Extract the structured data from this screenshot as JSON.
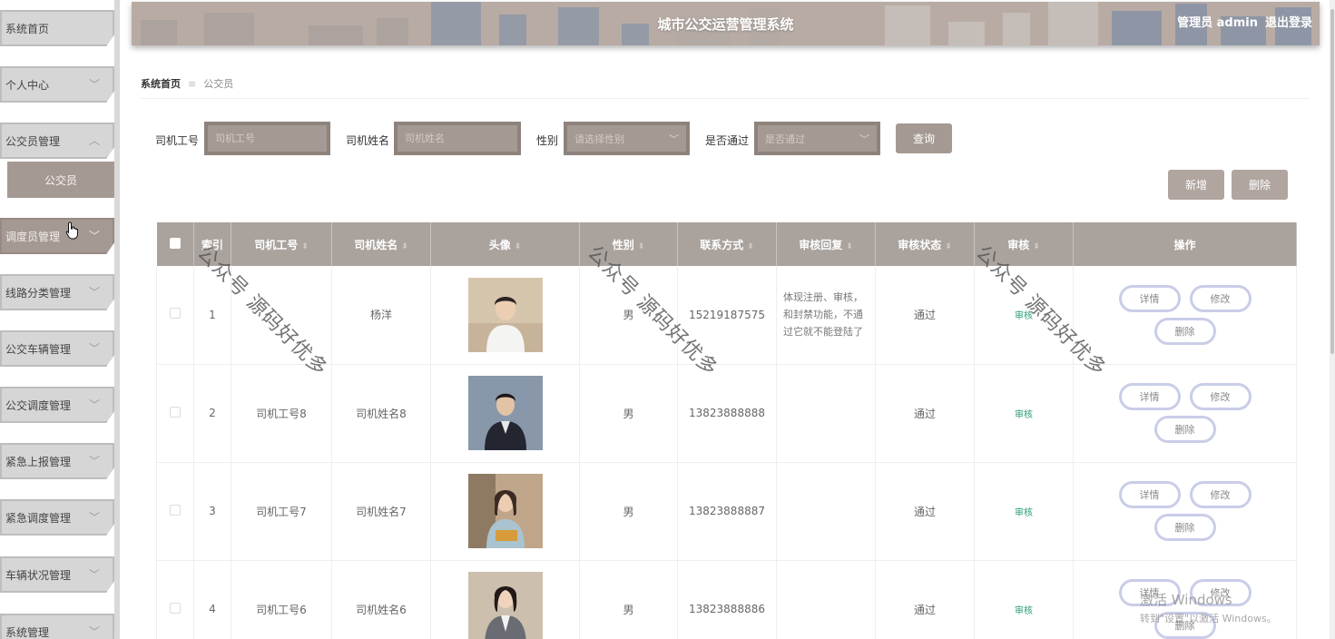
{
  "header": {
    "title": "城市公交运营管理系统",
    "user": "管理员 admin",
    "logout": "退出登录"
  },
  "sidebar": {
    "items": [
      {
        "label": "系统首页",
        "chevron": ""
      },
      {
        "label": "个人中心",
        "chevron": "﹀"
      },
      {
        "label": "公交员管理",
        "chevron": "︿"
      },
      {
        "label": "调度员管理",
        "chevron": "﹀"
      },
      {
        "label": "线路分类管理",
        "chevron": "﹀"
      },
      {
        "label": "公交车辆管理",
        "chevron": "﹀"
      },
      {
        "label": "公交调度管理",
        "chevron": "﹀"
      },
      {
        "label": "紧急上报管理",
        "chevron": "﹀"
      },
      {
        "label": "紧急调度管理",
        "chevron": "﹀"
      },
      {
        "label": "车辆状况管理",
        "chevron": "﹀"
      },
      {
        "label": "系统管理",
        "chevron": "﹀"
      }
    ],
    "submenu": {
      "label": "公交员"
    }
  },
  "breadcrumb": {
    "home": "系统首页",
    "separator": "≡",
    "current": "公交员"
  },
  "search": {
    "driver_id_label": "司机工号",
    "driver_id_placeholder": "司机工号",
    "driver_name_label": "司机姓名",
    "driver_name_placeholder": "司机姓名",
    "gender_label": "性别",
    "gender_placeholder": "请选择性别",
    "passed_label": "是否通过",
    "passed_placeholder": "是否通过",
    "query_button": "查询"
  },
  "actions": {
    "add": "新增",
    "delete": "删除"
  },
  "table": {
    "columns": [
      "索引",
      "司机工号",
      "司机姓名",
      "头像",
      "性别",
      "联系方式",
      "审核回复",
      "审核状态",
      "审核",
      "操作"
    ],
    "rows": [
      {
        "index": "1",
        "driver_id": "",
        "driver_name": "杨洋",
        "gender": "男",
        "phone": "15219187575",
        "reply": "体现注册、审核，和封禁功能，不通过它就不能登陆了",
        "status": "通过",
        "audit": "审核"
      },
      {
        "index": "2",
        "driver_id": "司机工号8",
        "driver_name": "司机姓名8",
        "gender": "男",
        "phone": "13823888888",
        "reply": "",
        "status": "通过",
        "audit": "审核"
      },
      {
        "index": "3",
        "driver_id": "司机工号7",
        "driver_name": "司机姓名7",
        "gender": "男",
        "phone": "13823888887",
        "reply": "",
        "status": "通过",
        "audit": "审核"
      },
      {
        "index": "4",
        "driver_id": "司机工号6",
        "driver_name": "司机姓名6",
        "gender": "男",
        "phone": "13823888886",
        "reply": "",
        "status": "通过",
        "audit": "审核"
      }
    ],
    "op_labels": {
      "detail": "详情",
      "edit": "修改",
      "delete": "删除"
    }
  },
  "watermark": "公众号 源码好优多",
  "activation": {
    "title": "激活 Windows",
    "subtitle": "转到\"设置\"以激活 Windows。"
  },
  "colors": {
    "accent": "#a59a93",
    "header_bg": "#b8aba4",
    "table_header": "#a9a29d",
    "audit_link": "#2a9c72",
    "op_border": "#c9cde8"
  }
}
